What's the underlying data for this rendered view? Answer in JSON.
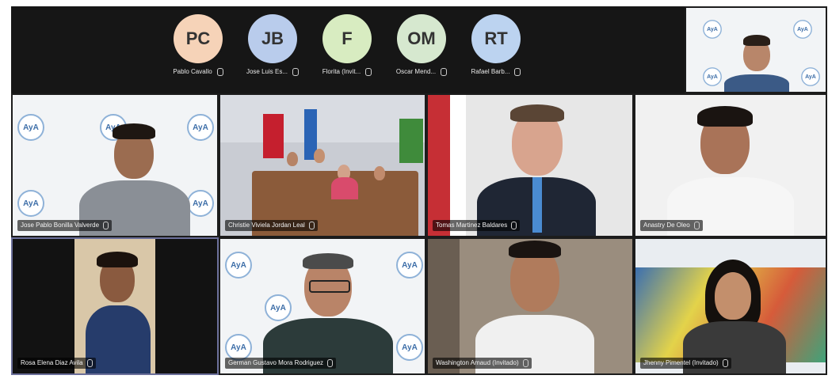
{
  "header": {
    "participants": [
      {
        "initials": "PC",
        "name": "Pablo Cavallo",
        "color": "#f6d3b8"
      },
      {
        "initials": "JB",
        "name": "Jose Luis Es...",
        "color": "#b9ccec"
      },
      {
        "initials": "F",
        "name": "Florita (Invit...",
        "color": "#d8ecc1"
      },
      {
        "initials": "OM",
        "name": "Oscar Mend...",
        "color": "#d6e8cf"
      },
      {
        "initials": "RT",
        "name": "Rafael Barb...",
        "color": "#bcd3f0"
      }
    ]
  },
  "tiles": [
    {
      "label": "Jose Pablo Bonilla Valverde"
    },
    {
      "label": "Christie Viviela Jordan Leal"
    },
    {
      "label": "Tomas Martinez Baldares"
    },
    {
      "label": "Anastry De Oleo"
    },
    {
      "label": "Rosa Elena Diaz Avila"
    },
    {
      "label": "German Gustavo Mora Rodriguez"
    },
    {
      "label": "Washington Amaud (Invitado)"
    },
    {
      "label": "Jhenny Pimentel (Invitado)"
    }
  ],
  "logo_text": "AyA"
}
